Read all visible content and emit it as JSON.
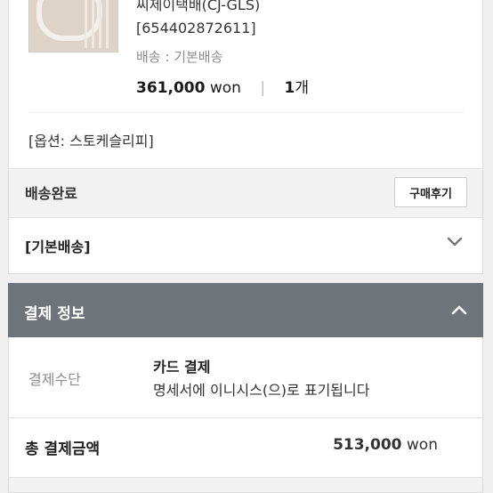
{
  "order": {
    "carrier": "씨제이택배(CJ-GLS)",
    "tracking": "[654402872611]",
    "shipping_method": "배송 : 기본배송",
    "price": "361,000",
    "price_unit": "won",
    "separator": "|",
    "quantity": "1",
    "quantity_unit": "개",
    "option": "[옵션: 스토케슬리피]",
    "status": "배송완료",
    "review_button": "구매후기"
  },
  "shipping_group": {
    "label": "[기본배송]",
    "icon": "chevron-down-icon"
  },
  "payment": {
    "title": "결제 정보",
    "toggle_icon": "chevron-up-icon",
    "method_label": "결제수단",
    "method_value": "카드 결제",
    "method_note": "명세서에 이니시스(으)로 표기됩니다",
    "total_label": "총 결제금액",
    "total_amount": "513,000",
    "total_unit": "won"
  },
  "colors": {
    "header_gray": "#6f737a",
    "page_bg": "#efefef",
    "status_bar_bg": "#f2f2f2"
  }
}
